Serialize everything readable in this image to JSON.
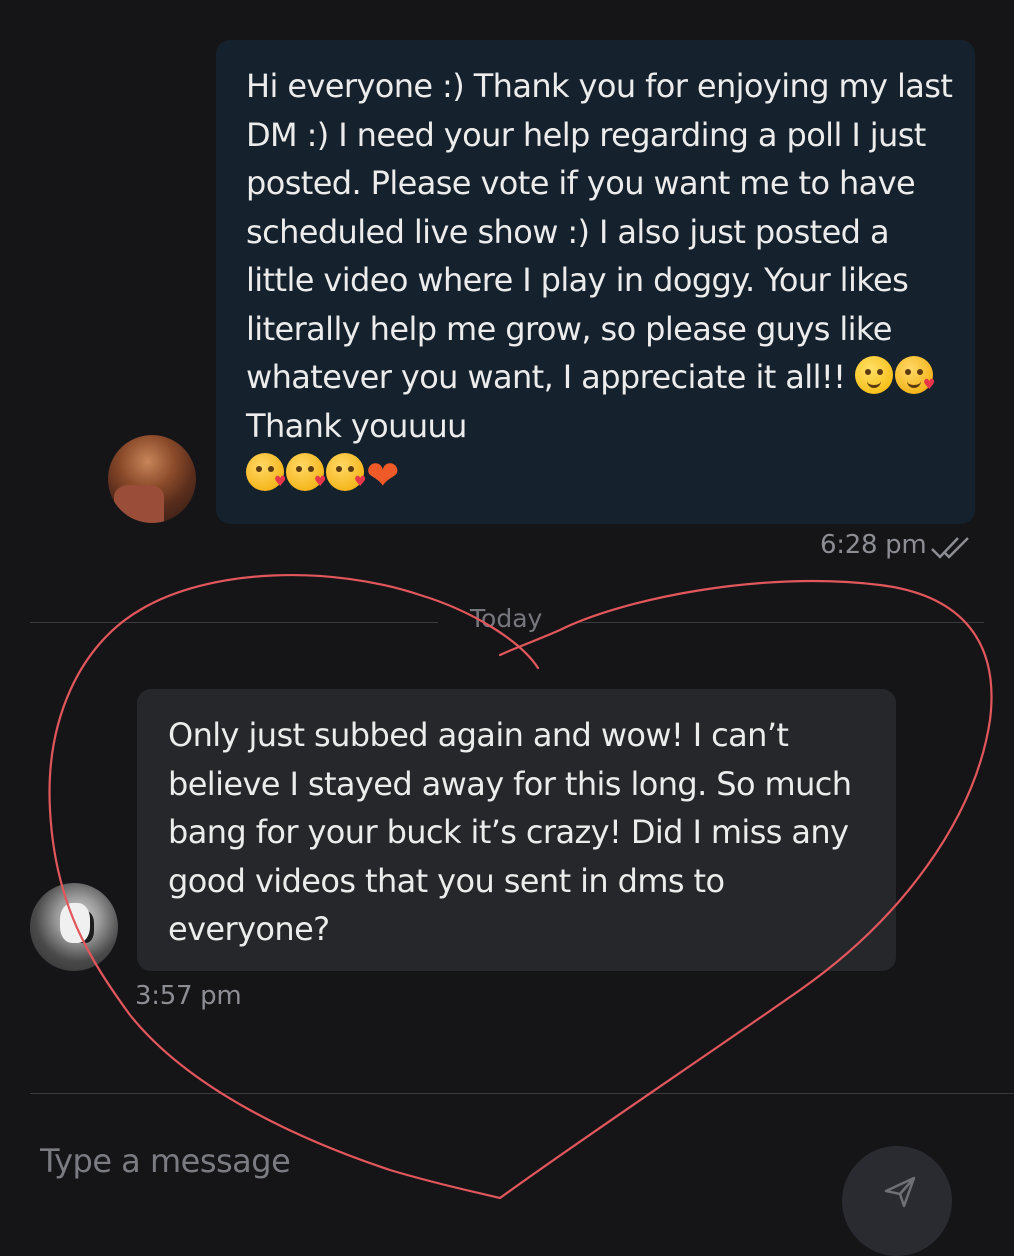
{
  "chat": {
    "outgoing": {
      "text": "Hi everyone :) Thank you for enjoying my last DM :) I need your help regarding a poll I just posted. Please vote if you want me to have scheduled live show :) I also just posted a little video where I play in doggy. Your likes literally help me grow, so please guys like whatever you want, I appreciate it all!!",
      "text_after_emoji": "Thank youuuu",
      "emojis_inline": [
        "smiling-face-emoji",
        "smiling-face-with-hearts-emoji"
      ],
      "emojis_end": [
        "face-blowing-kiss-emoji",
        "face-blowing-kiss-emoji",
        "face-blowing-kiss-emoji",
        "orange-heart-emoji"
      ],
      "time": "6:28 pm",
      "status_icon": "double-check-icon"
    },
    "date_divider": "Today",
    "incoming": {
      "text": "Only just subbed again and wow! I can’t believe I stayed away for this long. So much bang for your buck it’s crazy! Did I miss any good videos that you sent in dms to everyone?",
      "time": "3:57 pm"
    }
  },
  "composer": {
    "placeholder": "Type a message",
    "send_icon": "send-icon"
  },
  "colors": {
    "background": "#151518",
    "outgoing_bubble": "#15222d",
    "incoming_bubble": "#26272b",
    "annotation_stroke": "#e2575c"
  }
}
